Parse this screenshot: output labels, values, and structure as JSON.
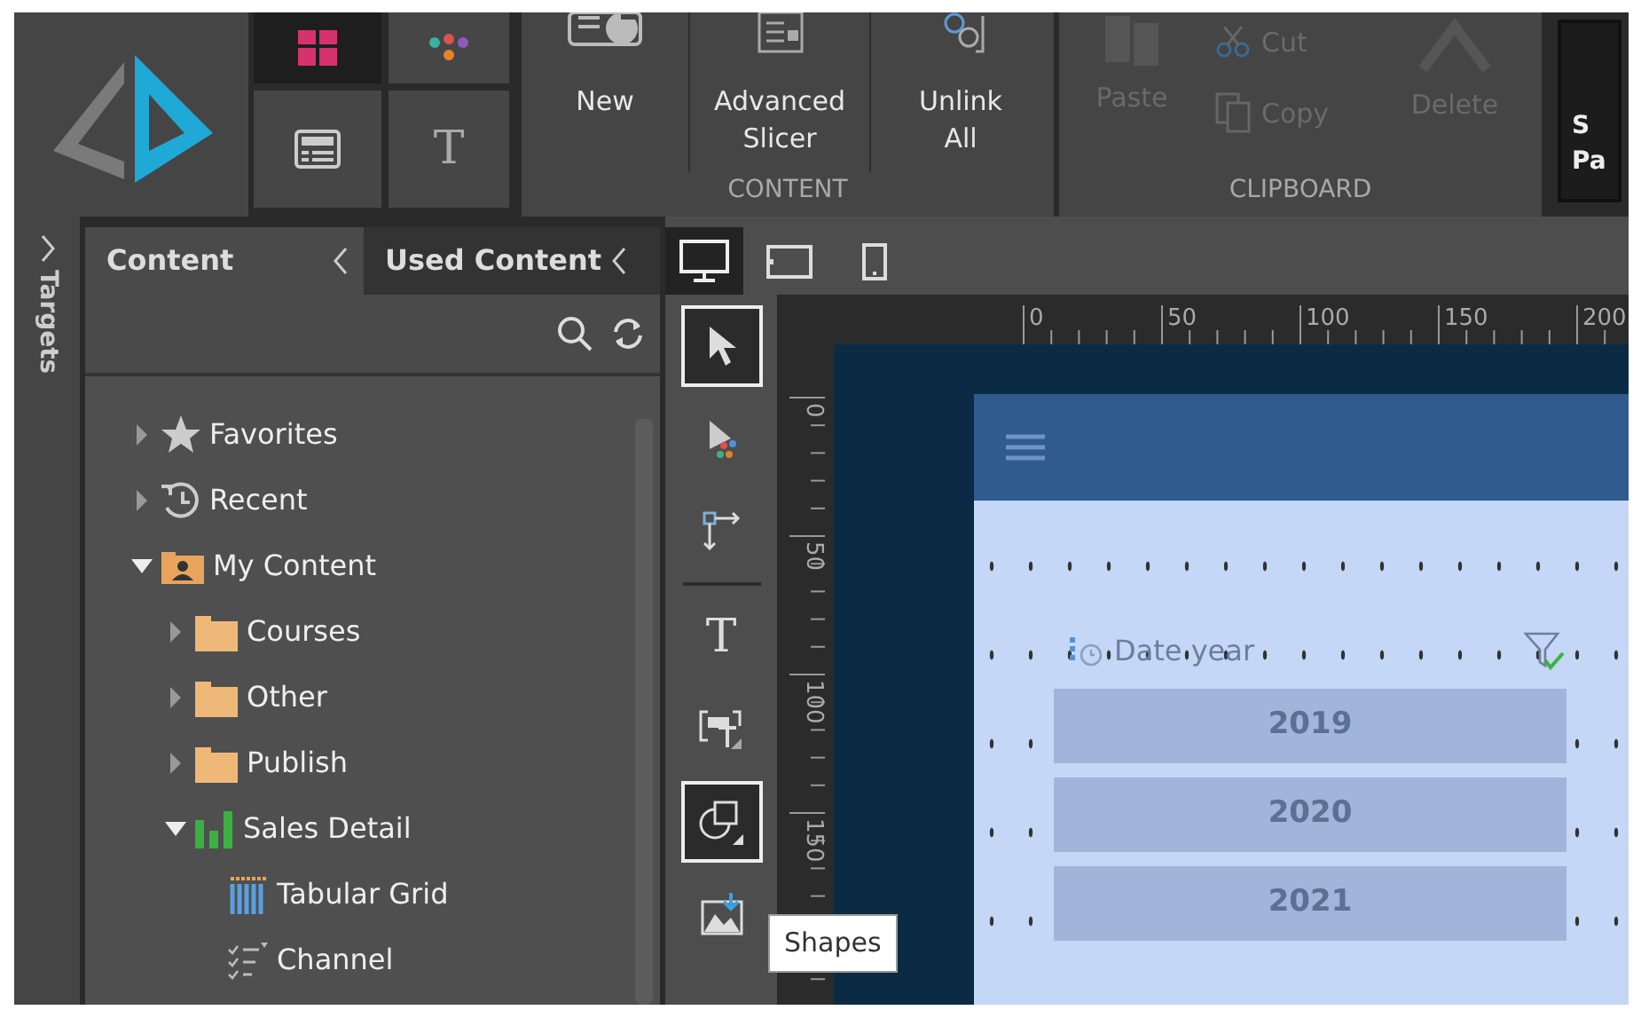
{
  "ribbon": {
    "tiles": [
      {
        "kind": "layout",
        "selected": true
      },
      {
        "kind": "palette",
        "selected": false
      },
      {
        "kind": "card",
        "selected": false
      },
      {
        "kind": "text",
        "glyph": "T",
        "selected": false
      }
    ],
    "groups": [
      {
        "label": "CONTENT",
        "buttons": [
          {
            "kind": "new",
            "label": "New",
            "disabled": false
          },
          {
            "kind": "slicer",
            "label": "Advanced Slicer",
            "disabled": false
          },
          {
            "kind": "unlink",
            "label": "Unlink All",
            "disabled": false
          }
        ]
      },
      {
        "label": "CLIPBOARD",
        "buttons": [
          {
            "kind": "paste",
            "label": "Paste",
            "disabled": true
          },
          {
            "kind": "cut",
            "label": "Cut",
            "disabled": true
          },
          {
            "kind": "copy",
            "label": "Copy",
            "disabled": true
          },
          {
            "kind": "delete",
            "label": "Delete",
            "disabled": true
          }
        ]
      }
    ],
    "overflow_button": {
      "lines": [
        "S",
        "Pa"
      ]
    }
  },
  "targets_tab": {
    "label": "Targets"
  },
  "content_panel": {
    "tabs": [
      {
        "label": "Content",
        "selected": true
      },
      {
        "label": "Used Content",
        "selected": false
      }
    ],
    "tree": [
      {
        "kind": "favorites",
        "label": "Favorites",
        "expanded": false
      },
      {
        "kind": "recent",
        "label": "Recent",
        "expanded": false
      },
      {
        "kind": "user-folder",
        "label": "My Content",
        "expanded": true,
        "children": [
          {
            "kind": "folder",
            "label": "Courses",
            "expanded": false
          },
          {
            "kind": "folder",
            "label": "Other",
            "expanded": false
          },
          {
            "kind": "folder",
            "label": "Publish",
            "expanded": false
          },
          {
            "kind": "report",
            "label": "Sales Detail",
            "expanded": true,
            "children": [
              {
                "kind": "grid",
                "label": "Tabular Grid"
              },
              {
                "kind": "list",
                "label": "Channel"
              }
            ]
          }
        ]
      }
    ]
  },
  "device_bar": [
    {
      "kind": "desktop",
      "selected": true
    },
    {
      "kind": "tablet",
      "selected": false
    },
    {
      "kind": "phone",
      "selected": false
    }
  ],
  "tools": [
    {
      "kind": "select",
      "selected": true
    },
    {
      "kind": "multi-select",
      "selected": false
    },
    {
      "kind": "connector",
      "selected": false
    },
    {
      "kind": "text",
      "glyph": "T",
      "selected": false
    },
    {
      "kind": "textbox",
      "selected": false
    },
    {
      "kind": "shapes",
      "selected": true
    },
    {
      "kind": "image",
      "selected": false
    }
  ],
  "tooltip": "Shapes",
  "ruler": {
    "top_labels": [
      "0",
      "50",
      "100",
      "150",
      "200"
    ],
    "left_labels": [
      "0",
      "50",
      "100",
      "150"
    ]
  },
  "canvas": {
    "slicer": {
      "title": "Date year",
      "items": [
        {
          "label": "2019"
        },
        {
          "label": "2020"
        },
        {
          "label": "2021"
        }
      ]
    }
  }
}
